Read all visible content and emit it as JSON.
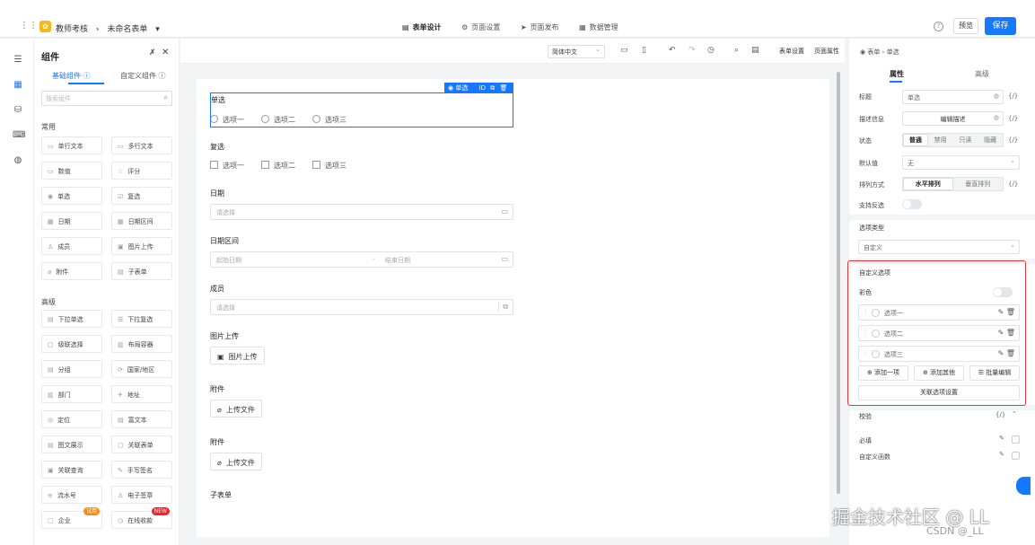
{
  "topbar": {
    "app_name": "教师考核",
    "form_name": "未命名表单",
    "tabs": [
      {
        "icon": "▤",
        "label": "表单设计"
      },
      {
        "icon": "⚙",
        "label": "页面设置"
      },
      {
        "icon": "➤",
        "label": "页面发布"
      },
      {
        "icon": "▦",
        "label": "数据管理"
      }
    ],
    "preview": "预览",
    "save": "保存"
  },
  "components": {
    "title": "组件",
    "tabs": [
      "基础组件 ⓘ",
      "自定义组件 ⓘ"
    ],
    "search_placeholder": "搜索组件",
    "common_label": "常用",
    "common": [
      {
        "icon": "▭",
        "label": "单行文本"
      },
      {
        "icon": "▭",
        "label": "多行文本"
      },
      {
        "icon": "▭",
        "label": "数值"
      },
      {
        "icon": "☆",
        "label": "评分"
      },
      {
        "icon": "◉",
        "label": "单选"
      },
      {
        "icon": "☑",
        "label": "复选"
      },
      {
        "icon": "▦",
        "label": "日期"
      },
      {
        "icon": "▦",
        "label": "日期区间"
      },
      {
        "icon": "♙",
        "label": "成员"
      },
      {
        "icon": "▣",
        "label": "图片上传"
      },
      {
        "icon": "⌀",
        "label": "附件"
      },
      {
        "icon": "▤",
        "label": "子表单"
      }
    ],
    "advanced_label": "高级",
    "advanced": [
      {
        "icon": "▤",
        "label": "下拉单选"
      },
      {
        "icon": "☰",
        "label": "下拉复选"
      },
      {
        "icon": "▢",
        "label": "级联选择"
      },
      {
        "icon": "▥",
        "label": "布局容器"
      },
      {
        "icon": "▤",
        "label": "分组"
      },
      {
        "icon": "⟳",
        "label": "国家/地区"
      },
      {
        "icon": "▥",
        "label": "部门"
      },
      {
        "icon": "✈",
        "label": "地址"
      },
      {
        "icon": "◎",
        "label": "定位"
      },
      {
        "icon": "▤",
        "label": "富文本"
      },
      {
        "icon": "▤",
        "label": "图文展示"
      },
      {
        "icon": "▢",
        "label": "关联表单"
      },
      {
        "icon": "▣",
        "label": "关联查询"
      },
      {
        "icon": "✎",
        "label": "手写签名"
      },
      {
        "icon": "≡",
        "label": "流水号"
      },
      {
        "icon": "♙",
        "label": "电子签章"
      },
      {
        "icon": "▢",
        "label": "企业",
        "badge": "试用"
      },
      {
        "icon": "◷",
        "label": "在线收款",
        "badge": "NEW"
      }
    ]
  },
  "canvas_bar": {
    "language": "简体中文",
    "form_settings": "表单设置",
    "page_props": "页面属性"
  },
  "form": {
    "selected_tag": "单选",
    "radio": {
      "label": "单选",
      "options": [
        "选项一",
        "选项二",
        "选项三"
      ]
    },
    "checkbox": {
      "label": "复选",
      "options": [
        "选项一",
        "选项二",
        "选项三"
      ]
    },
    "date": {
      "label": "日期",
      "placeholder": "请选择"
    },
    "date_range": {
      "label": "日期区间",
      "start": "起始日期",
      "sep": "-",
      "end": "结束日期"
    },
    "member": {
      "label": "成员",
      "placeholder": "请选择"
    },
    "image": {
      "label": "图片上传",
      "button": "图片上传"
    },
    "attach1": {
      "label": "附件",
      "button": "上传文件"
    },
    "attach2": {
      "label": "附件",
      "button": "上传文件"
    },
    "subform": {
      "label": "子表单"
    }
  },
  "props": {
    "crumb_root": "表单",
    "crumb_current": "单选",
    "tabs": [
      "属性",
      "高级"
    ],
    "title_label": "标题",
    "title_value": "单选",
    "desc_label": "描述信息",
    "desc_value": "编辑描述",
    "state_label": "状态",
    "state_options": [
      "普通",
      "禁用",
      "只读",
      "隐藏"
    ],
    "default_label": "默认值",
    "default_value": "无",
    "layout_label": "排列方式",
    "layout_options": [
      "水平排列",
      "垂直排列"
    ],
    "support_label": "支持反选",
    "option_type_label": "选项类型",
    "option_type_value": "自定义",
    "custom_label": "自定义选项",
    "color_label": "彩色",
    "options": [
      "选项一",
      "选项二",
      "选项三"
    ],
    "add_one": "添加一项",
    "add_other": "添加其他",
    "batch_edit": "批量编辑",
    "linked": "关联选项设置",
    "validate_label": "校验",
    "required_label": "必填",
    "custom_fn_label": "自定义函数",
    "fx": "{/}"
  },
  "watermark": {
    "main": "掘金技术社区 @ LL",
    "sub": "CSDN @_LL"
  },
  "colors": {
    "accent": "#1677ff",
    "highlight": "#e53935"
  }
}
